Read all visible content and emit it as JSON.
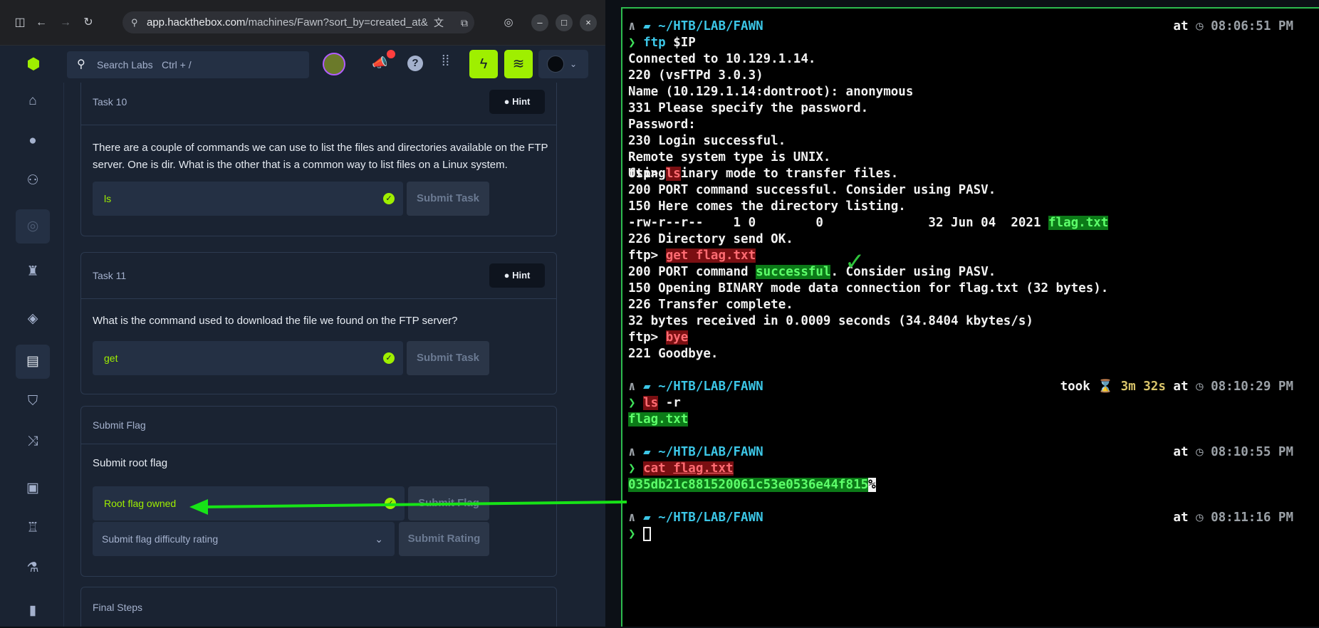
{
  "browser": {
    "url_host": "app.hackthebox.com",
    "url_path": "/machines/Fawn?sort_by=created_at&"
  },
  "topbar": {
    "search_placeholder": "Search Labs",
    "search_shortcut": "Ctrl + /"
  },
  "tasks": [
    {
      "title": "Task 10",
      "hint": "Hint",
      "question": "There are a couple of commands we can use to list the files and directories available on the FTP server. One is dir. What is the other that is a common way to list files on a Linux system.",
      "answer": "ls",
      "submit": "Submit Task"
    },
    {
      "title": "Task 11",
      "hint": "Hint",
      "question": "What is the command used to download the file we found on the FTP server?",
      "answer": "get",
      "submit": "Submit Task"
    }
  ],
  "submit_flag": {
    "title": "Submit Flag",
    "subtitle": "Submit root flag",
    "value": "Root flag owned",
    "submit": "Submit Flag",
    "rating_placeholder": "Submit flag difficulty rating",
    "rating_submit": "Submit Rating"
  },
  "final_steps": {
    "title": "Final Steps"
  },
  "terminal": {
    "prompts": [
      {
        "path": "~/HTB/LAB/FAWN",
        "took": "",
        "time": "08:06:51 PM"
      },
      {
        "path": "~/HTB/LAB/FAWN",
        "took": "3m 32s",
        "time": "08:10:29 PM"
      },
      {
        "path": "~/HTB/LAB/FAWN",
        "took": "",
        "time": "08:10:55 PM"
      },
      {
        "path": "~/HTB/LAB/FAWN",
        "took": "",
        "time": "08:11:16 PM"
      }
    ],
    "at": "at",
    "took_label": "took",
    "cmd1": "ftp",
    "cmd1_arg": "$IP",
    "lines_block1": [
      "Connected to 10.129.1.14.",
      "220 (vsFTPd 3.0.3)",
      "Name (10.129.1.14:dontroot): anonymous",
      "331 Please specify the password.",
      "Password:",
      "230 Login successful.",
      "Remote system type is UNIX.",
      "Using binary mode to transfer files."
    ],
    "ftp_prompt": "ftp>",
    "ftp_ls": "ls",
    "lines_block2": [
      "200 PORT command successful. Consider using PASV.",
      "150 Here comes the directory listing."
    ],
    "listing_prefix": "-rw-r--r--    1 0        0              32 Jun 04  2021 ",
    "listing_file": "flag.txt",
    "line_dir_ok": "226 Directory send OK.",
    "ftp_get": "get flag.txt",
    "port_pre": "200 PORT command ",
    "port_word": "successful",
    "port_post": ". Consider using PASV.",
    "lines_block3": [
      "150 Opening BINARY mode data connection for flag.txt (32 bytes).",
      "226 Transfer complete.",
      "32 bytes received in 0.0009 seconds (34.8404 kbytes/s)"
    ],
    "ftp_bye": "bye",
    "goodbye": "221 Goodbye.",
    "cmd2": "ls",
    "cmd2_arg": "-r",
    "ls_out": "flag.txt",
    "cmd3": "cat",
    "cmd3_arg": "flag.txt",
    "flag": "035db21c881520061c53e0536e44f815",
    "flag_end": "%"
  },
  "colors": {
    "accent": "#9fef00",
    "arrow": "#17e317",
    "terminal_border": "#2dbb4e"
  }
}
